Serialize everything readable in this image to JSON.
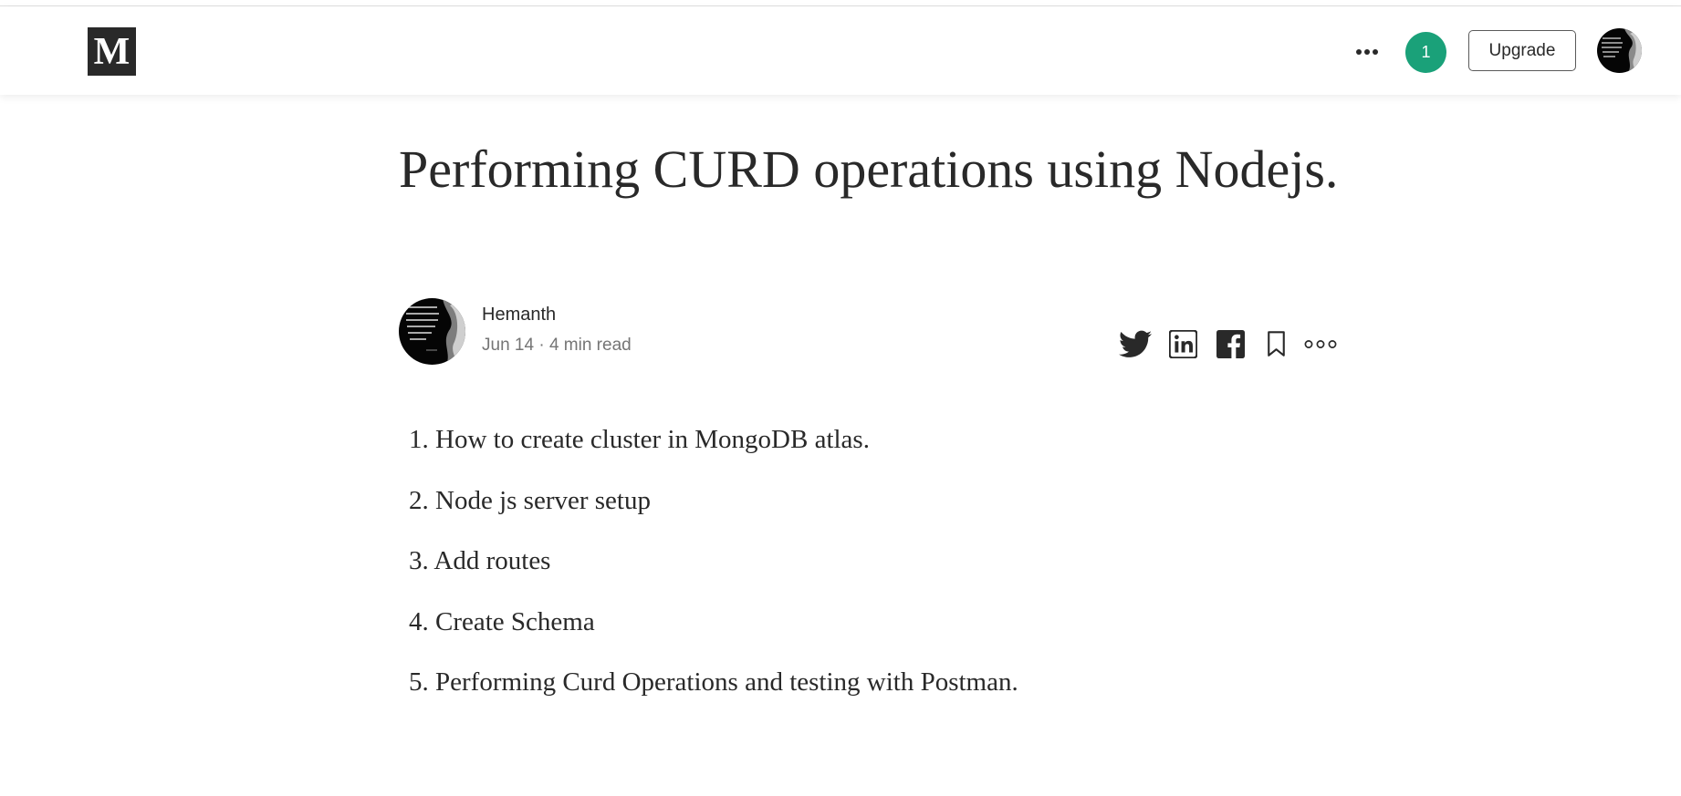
{
  "brand": {
    "logo_letter": "M"
  },
  "header": {
    "more_icon": "more-horizontal-icon",
    "notification_count": "1",
    "upgrade_label": "Upgrade",
    "accent_color": "#1aa179"
  },
  "article": {
    "title": "Performing CURD operations using Nodejs.",
    "author": "Hemanth",
    "date": "Jun 14",
    "separator": "·",
    "read_time": "4 min read",
    "share_icons": [
      "twitter-icon",
      "linkedin-icon",
      "facebook-icon",
      "bookmark-icon",
      "more-options-icon"
    ],
    "list": [
      {
        "num": "1.",
        "text": "How to create cluster in MongoDB atlas."
      },
      {
        "num": "2.",
        "text": "Node js server setup"
      },
      {
        "num": "3.",
        "text": "Add routes"
      },
      {
        "num": "4.",
        "text": "Create Schema"
      },
      {
        "num": "5.",
        "text": "Performing Curd Operations and testing with Postman."
      }
    ]
  }
}
